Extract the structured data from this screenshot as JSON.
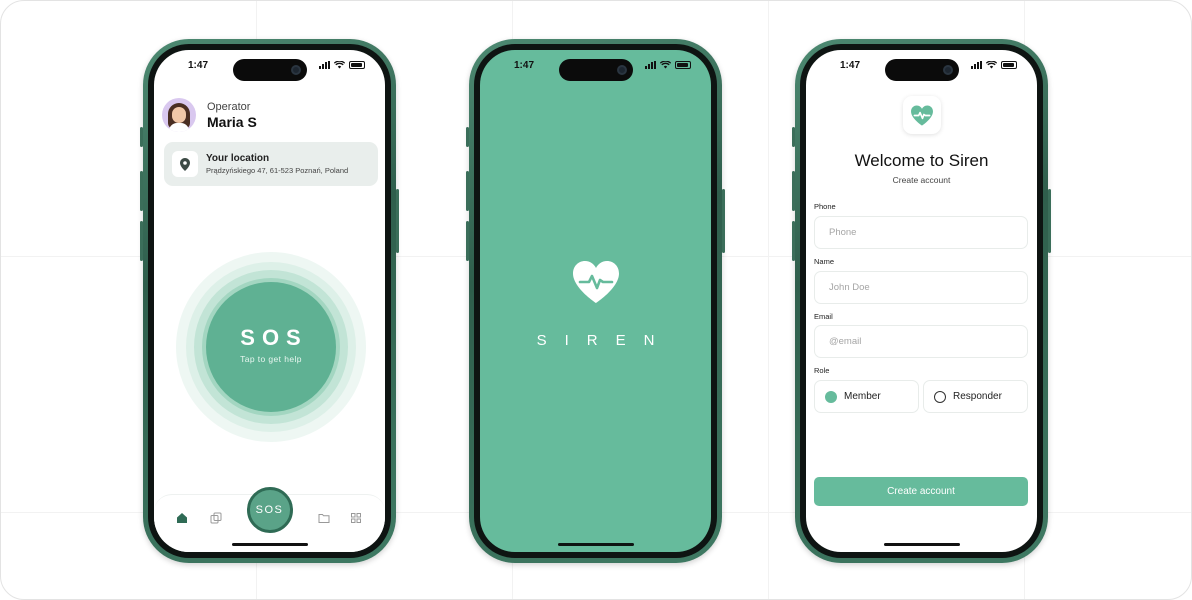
{
  "colors": {
    "brand": "#66bb9c",
    "brand_dark": "#2f6b55",
    "frame": "#3f7a63"
  },
  "phone1": {
    "status_time": "1:47",
    "operator_role": "Operator",
    "operator_name": "Maria S",
    "location_title": "Your location",
    "location_address": "Prądzyńskiego 47, 61-523 Poznań, Poland",
    "sos_label": "SOS",
    "sos_subtitle": "Tap to get help",
    "tab_icons": [
      "home-icon",
      "copy-icon",
      "folder-icon",
      "grid-icon"
    ],
    "fab_label": "SOS"
  },
  "phone2": {
    "status_time": "1:47",
    "app_name": "SIREN"
  },
  "phone3": {
    "status_time": "1:47",
    "title": "Welcome to Siren",
    "subtitle": "Create account",
    "phone_label": "Phone",
    "phone_placeholder": "Phone",
    "name_label": "Name",
    "name_placeholder": "John Doe",
    "email_label": "Email",
    "email_placeholder": "@email",
    "role_label": "Role",
    "role_member": "Member",
    "role_responder": "Responder",
    "role_selected": "Member",
    "create_button": "Create account"
  }
}
